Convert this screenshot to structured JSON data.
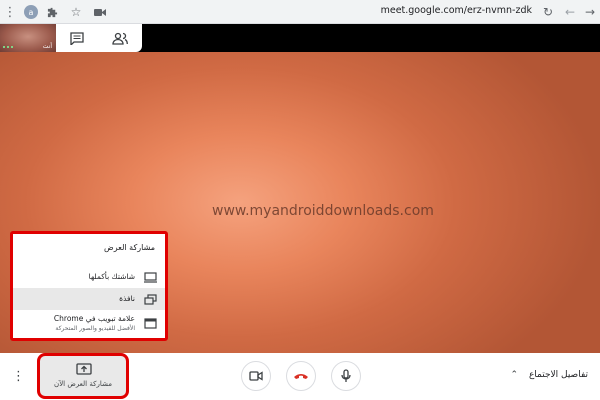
{
  "browser": {
    "avatar_letter": "a",
    "url": "meet.google.com/erz-nvmn-zdk",
    "icons": [
      "menu-dots-icon",
      "avatar",
      "extensions-icon",
      "star-icon",
      "camera-icon",
      "reload-icon",
      "back-icon",
      "forward-icon"
    ]
  },
  "top": {
    "self_label": "أنت"
  },
  "video": {
    "watermark": "www.myandroiddownloads.com"
  },
  "share_menu": {
    "title": "مشاركة العرض",
    "items": [
      {
        "label": "شاشتك بأكملها",
        "sub": ""
      },
      {
        "label": "نافذة",
        "sub": ""
      },
      {
        "label": "علامة تبويب في Chrome",
        "sub": "الأفضل للفيديو والصور المتحركة"
      }
    ]
  },
  "bottom": {
    "present_label": "مشاركة العرض الآن",
    "details_label": "تفاصيل الاجتماع"
  },
  "colors": {
    "highlight": "#e00000",
    "hangup": "#d93025"
  }
}
